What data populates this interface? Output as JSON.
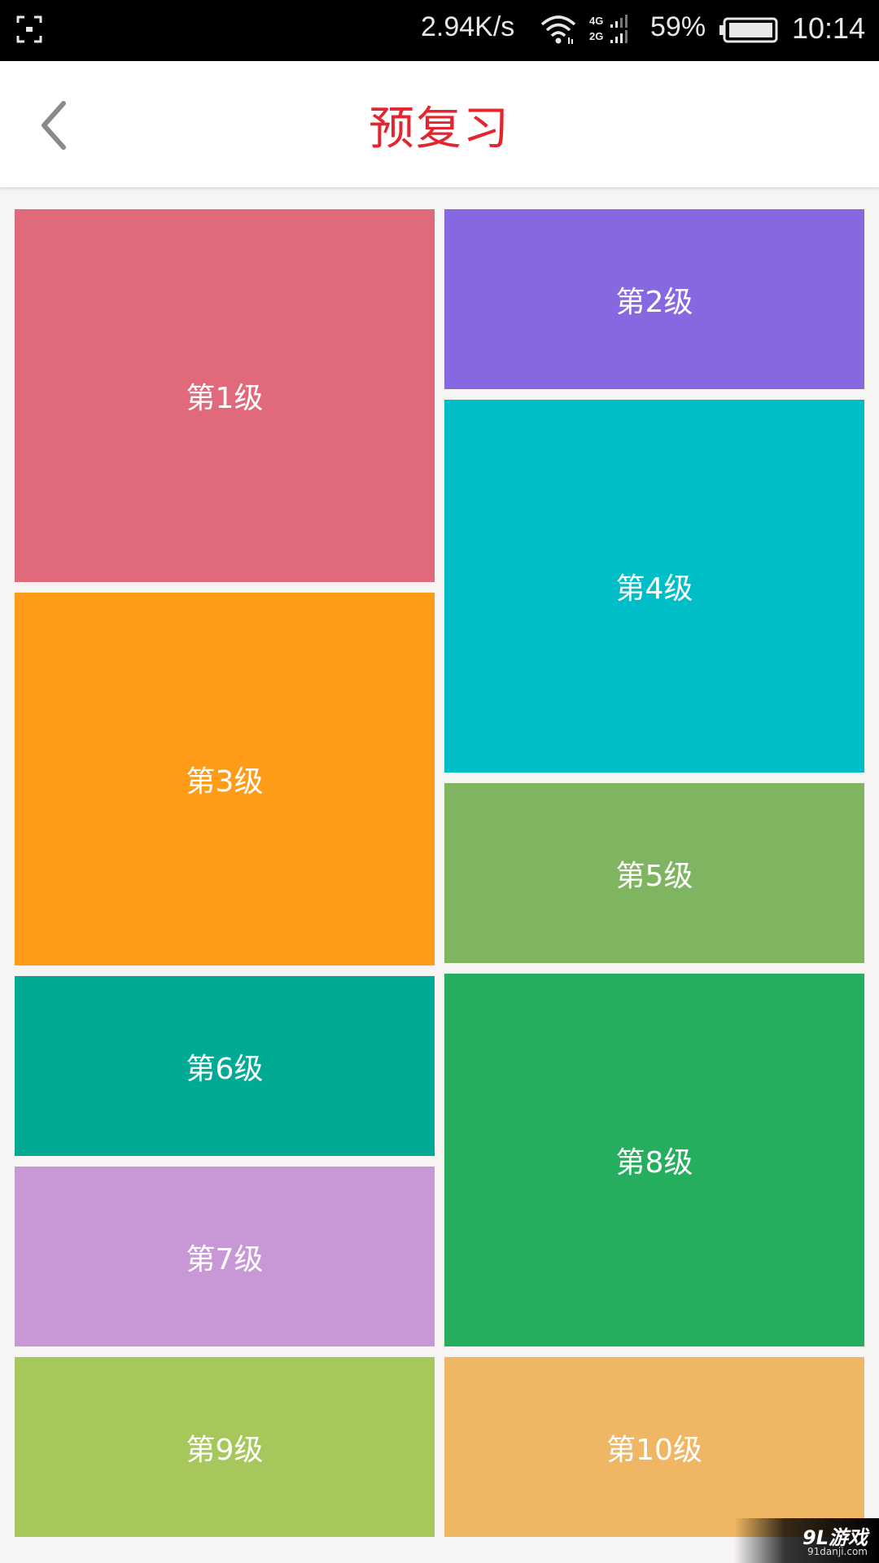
{
  "status_bar": {
    "network_speed": "2.94K/s",
    "battery_percent": "59%",
    "time": "10:14",
    "icons": [
      "screenshot-frame-icon",
      "wifi-icon",
      "cellular-4g-2g-icon",
      "battery-icon"
    ]
  },
  "header": {
    "title": "预复习",
    "back_icon": "chevron-left-icon",
    "title_color": "#e2252e"
  },
  "levels": [
    {
      "label": "第1级",
      "color": "#e0697b"
    },
    {
      "label": "第2级",
      "color": "#8768e0"
    },
    {
      "label": "第3级",
      "color": "#ff9c17"
    },
    {
      "label": "第4级",
      "color": "#00bec7"
    },
    {
      "label": "第5级",
      "color": "#7fb560"
    },
    {
      "label": "第6级",
      "color": "#00aa94"
    },
    {
      "label": "第7级",
      "color": "#c797d6"
    },
    {
      "label": "第8级",
      "color": "#25ae5d"
    },
    {
      "label": "第9级",
      "color": "#a5c75b"
    },
    {
      "label": "第10级",
      "color": "#efb764"
    }
  ],
  "watermark": {
    "mark": "9L游戏",
    "sub": "91danji.com"
  }
}
